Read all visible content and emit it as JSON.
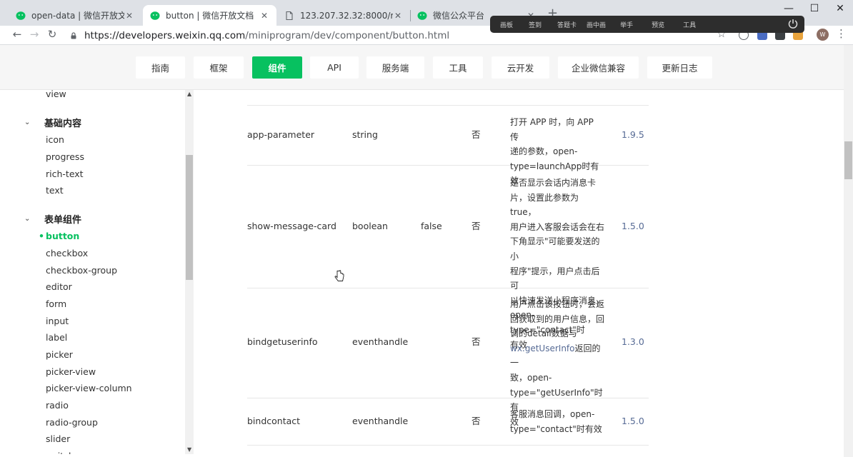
{
  "browser": {
    "tabs": [
      {
        "title": "open-data | 微信开放文档"
      },
      {
        "title": "button | 微信开放文档"
      },
      {
        "title": "123.207.32.32:8000/recommer"
      },
      {
        "title": "微信公众平台"
      }
    ],
    "url_host": "https://developers.weixin.qq.com",
    "url_path": "/miniprogram/dev/component/button.html",
    "profile_initial": "W",
    "icons": {
      "back": "arrow-left-icon",
      "forward": "arrow-right-icon",
      "reload": "reload-icon",
      "lock": "lock-icon",
      "star": "star-icon",
      "menu": "kebab-menu-icon"
    }
  },
  "recorder_toolbar": {
    "items": [
      "画板",
      "签到",
      "答题卡",
      "画中画",
      "举手",
      "预览",
      "工具"
    ]
  },
  "topnav": {
    "items": [
      "指南",
      "框架",
      "组件",
      "API",
      "服务端",
      "工具",
      "云开发",
      "企业微信兼容",
      "更新日志"
    ],
    "active": "组件"
  },
  "sidebar": {
    "prev_item": "view",
    "group1": {
      "label": "基础内容",
      "items": [
        "icon",
        "progress",
        "rich-text",
        "text"
      ]
    },
    "group2": {
      "label": "表单组件",
      "items": [
        "button",
        "checkbox",
        "checkbox-group",
        "editor",
        "form",
        "input",
        "label",
        "picker",
        "picker-view",
        "picker-view-column",
        "radio",
        "radio-group",
        "slider",
        "switch"
      ]
    },
    "current": "button"
  },
  "table": {
    "top_partial_desc": "有效",
    "rows": [
      {
        "name": "app-parameter",
        "type": "string",
        "default": "",
        "required": "否",
        "desc_lines": [
          "打开 APP 时，向 APP 传",
          "递的参数，open-",
          "type=launchApp时有效"
        ],
        "version": "1.9.5"
      },
      {
        "name": "show-message-card",
        "type": "boolean",
        "default": "false",
        "required": "否",
        "desc_lines": [
          "是否显示会话内消息卡",
          "片，设置此参数为 true，",
          "用户进入客服会话会在右",
          "下角显示\"可能要发送的小",
          "程序\"提示，用户点击后可",
          "以快速发送小程序消息，",
          "open-type=\"contact\"时",
          "有效"
        ],
        "version": "1.5.0"
      },
      {
        "name": "bindgetuserinfo",
        "type": "eventhandle",
        "default": "",
        "required": "否",
        "desc_lines": [
          "用户点击该按钮时，会返",
          "回获取到的用户信息，回",
          "调的detail数据与",
          "wx.getUserInfo",
          "返回的一",
          "致，open-",
          "type=\"getUserInfo\"时有",
          "效"
        ],
        "version": "1.3.0"
      },
      {
        "name": "bindcontact",
        "type": "eventhandle",
        "default": "",
        "required": "否",
        "desc_lines": [
          "客服消息回调，open-",
          "type=\"contact\"时有效"
        ],
        "version": "1.5.0"
      }
    ]
  },
  "colors": {
    "accent": "#07c160",
    "link": "#576b95",
    "nav_bg": "#f6f6f6"
  }
}
